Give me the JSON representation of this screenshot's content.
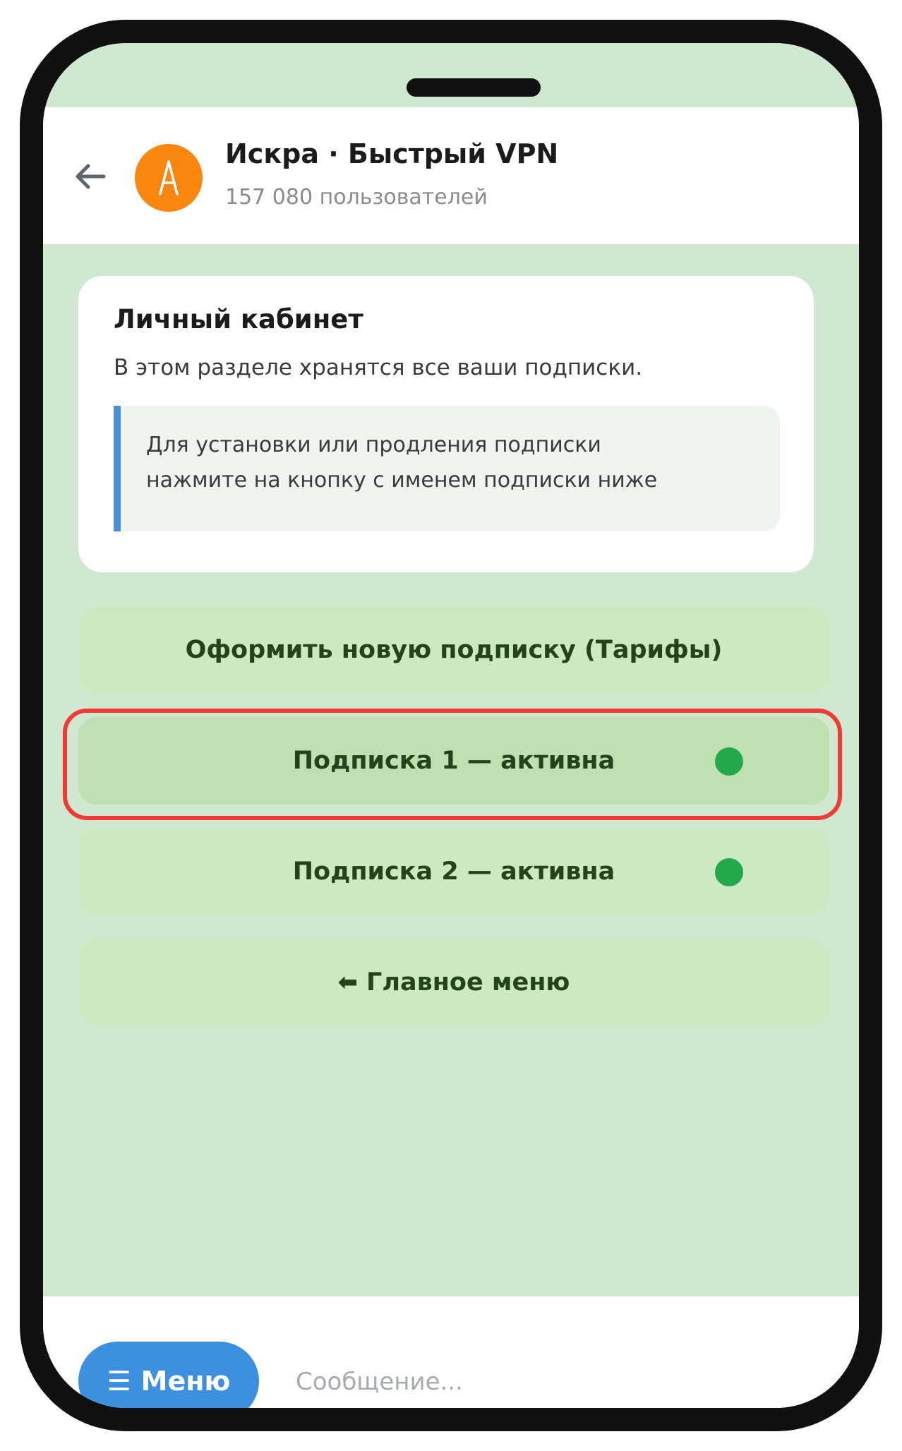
{
  "header": {
    "title": "Искра · Быстрый VPN",
    "subtitle": "157 080 пользователей",
    "avatar_letter": "A"
  },
  "card": {
    "title": "Личный кабинет",
    "text": "В этом разделе хранятся все ваши подписки.",
    "quote_lines": [
      "Для установки или продления подписки",
      "нажмите на кнопку с именем подписки ниже"
    ]
  },
  "keyboard": {
    "buttons": [
      {
        "label": "Оформить новую подписку (Тарифы)"
      },
      {
        "label": "Подписка 1 — активна",
        "status": "active",
        "selected": true
      },
      {
        "label": "Подписка 2 — активна",
        "status": "active"
      },
      {
        "label": "Главное меню",
        "icon": "arrow-left-icon"
      }
    ]
  },
  "footer": {
    "menu_label": "Меню",
    "input_placeholder": "Сообщение..."
  },
  "colors": {
    "background": "#d0e8d0",
    "button": "#cde9c1",
    "button_selected": "#c1e0b1",
    "accent": "#3d8fe0",
    "avatar": "#f8860f",
    "status_active": "#23a84a",
    "highlight": "#ee3b35"
  }
}
